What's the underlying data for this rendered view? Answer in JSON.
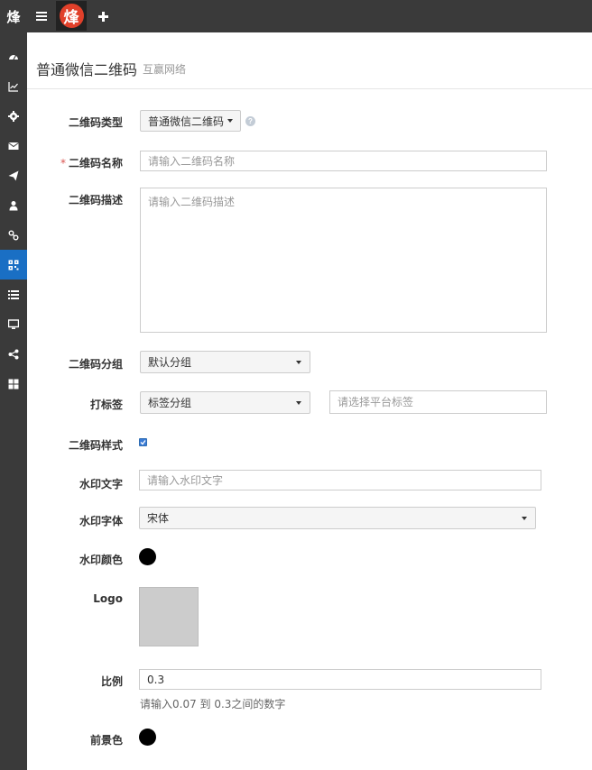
{
  "topbar": {
    "brand_char": "烽",
    "logo_char": "烽"
  },
  "header": {
    "title": "普通微信二维码",
    "subtitle": "互赢网络"
  },
  "form": {
    "type_label": "二维码类型",
    "type_value": "普通微信二维码",
    "name_label": "二维码名称",
    "name_required": "*",
    "name_placeholder": "请输入二维码名称",
    "desc_label": "二维码描述",
    "desc_placeholder": "请输入二维码描述",
    "group_label": "二维码分组",
    "group_value": "默认分组",
    "tag_label": "打标签",
    "tag_group_value": "标签分组",
    "tag_placeholder": "请选择平台标签",
    "style_label": "二维码样式",
    "style_checked": true,
    "watermark_text_label": "水印文字",
    "watermark_text_placeholder": "请输入水印文字",
    "watermark_font_label": "水印字体",
    "watermark_font_value": "宋体",
    "watermark_color_label": "水印颜色",
    "watermark_color": "#000000",
    "logo_label": "Logo",
    "ratio_label": "比例",
    "ratio_value": "0.3",
    "ratio_hint": "请输入0.07 到 0.3之间的数字",
    "fg_label": "前景色",
    "fg_color": "#000000"
  },
  "colors": {
    "sidebar_bg": "#3a3a3a",
    "active": "#1a6fc4",
    "logo": "#e1402a"
  }
}
